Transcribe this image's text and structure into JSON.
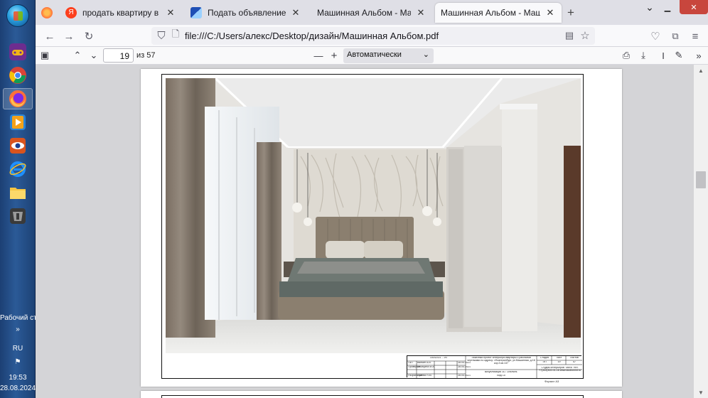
{
  "taskbar": {
    "desktop_label": "Рабочий сто",
    "expand_label": "»",
    "lang": "RU",
    "time": "19:53",
    "date": "28.08.2024"
  },
  "browser": {
    "tabs": [
      {
        "title": "продать квартиру в екатеринб",
        "icon": "yandex-icon",
        "color": "#fc3f1d",
        "active": false
      },
      {
        "title": "Подать объявление о продаж",
        "icon": "avito-icon",
        "color": "#1f4fb5",
        "active": false
      },
      {
        "title": "Машинная Альбом - Машинная А",
        "icon": "pdf-icon",
        "color": "#ffffff",
        "active": false
      },
      {
        "title": "Машинная Альбом - Машинная А",
        "icon": "pdf-icon",
        "color": "#ffffff",
        "active": true
      }
    ],
    "new_tab": "+",
    "url": "file:///C:/Users/алекс/Desktop/дизайн/Машинная Альбом.pdf"
  },
  "pdf": {
    "page_current": "19",
    "page_total": "из 57",
    "zoom": "Автоматически"
  },
  "stamp": {
    "code": "15042021 - ЭП",
    "project": "Эскизный проект интерьера квартиры с рабочими чертежами по адресу: г.Екатеринбург, ул.Машинная, д.16 кор.3 кв.137",
    "viz": "Визуализация 3D. Спальня.",
    "view": "Вид 15",
    "stage_h": "Стадия",
    "stage": "ЭП",
    "sheet_h": "Лист",
    "sheet": "19",
    "sheets_h": "Листов",
    "sheets": "57",
    "studio": "Студия интерьеров \"Мята\" тел: +7(343)302-01-16 www.studiomint.ru",
    "rows": [
      {
        "role": "ГАП",
        "name": "Вялкин А.В."
      },
      {
        "role": "Проверил",
        "name": "Лисицина М.А."
      },
      {
        "role": "Разработал",
        "name": "Лунева Н.М."
      }
    ],
    "dates": [
      "28.04.2021",
      "28.04.2021",
      "28.04.2021"
    ],
    "form": "Формат А3"
  }
}
